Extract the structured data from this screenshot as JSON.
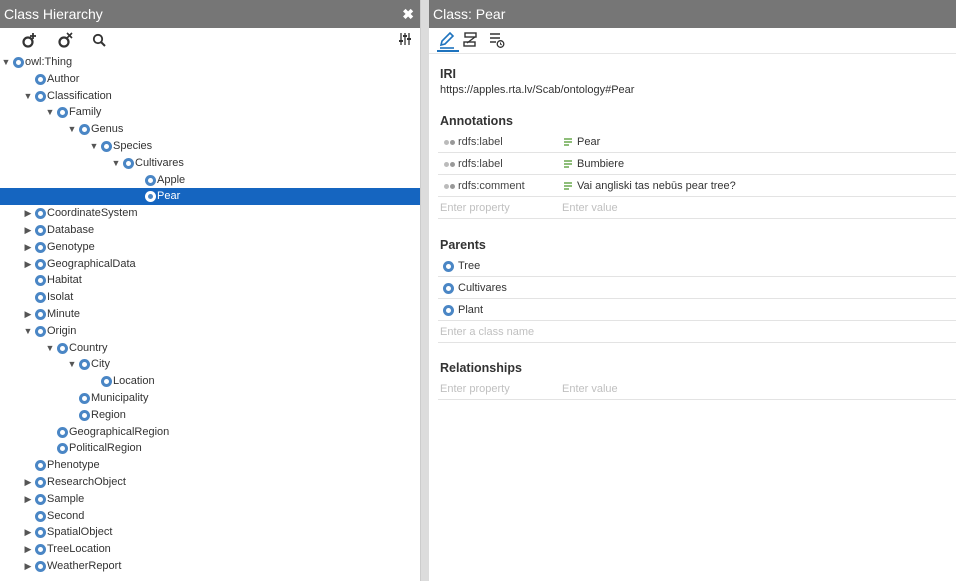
{
  "left_panel": {
    "title": "Class Hierarchy",
    "close_glyph": "✖",
    "tree": [
      {
        "label": "owl:Thing",
        "depth": 0,
        "state": "expanded"
      },
      {
        "label": "Author",
        "depth": 1,
        "state": "leaf"
      },
      {
        "label": "Classification",
        "depth": 1,
        "state": "expanded"
      },
      {
        "label": "Family",
        "depth": 2,
        "state": "expanded"
      },
      {
        "label": "Genus",
        "depth": 3,
        "state": "expanded"
      },
      {
        "label": "Species",
        "depth": 4,
        "state": "expanded"
      },
      {
        "label": "Cultivares",
        "depth": 5,
        "state": "expanded"
      },
      {
        "label": "Apple",
        "depth": 6,
        "state": "leaf"
      },
      {
        "label": "Pear",
        "depth": 6,
        "state": "leaf",
        "selected": true
      },
      {
        "label": "CoordinateSystem",
        "depth": 1,
        "state": "collapsed"
      },
      {
        "label": "Database",
        "depth": 1,
        "state": "collapsed"
      },
      {
        "label": "Genotype",
        "depth": 1,
        "state": "collapsed"
      },
      {
        "label": "GeographicalData",
        "depth": 1,
        "state": "collapsed"
      },
      {
        "label": "Habitat",
        "depth": 1,
        "state": "leaf"
      },
      {
        "label": "Isolat",
        "depth": 1,
        "state": "leaf"
      },
      {
        "label": "Minute",
        "depth": 1,
        "state": "collapsed"
      },
      {
        "label": "Origin",
        "depth": 1,
        "state": "expanded"
      },
      {
        "label": "Country",
        "depth": 2,
        "state": "expanded"
      },
      {
        "label": "City",
        "depth": 3,
        "state": "expanded"
      },
      {
        "label": "Location",
        "depth": 4,
        "state": "leaf"
      },
      {
        "label": "Municipality",
        "depth": 3,
        "state": "leaf"
      },
      {
        "label": "Region",
        "depth": 3,
        "state": "leaf"
      },
      {
        "label": "GeographicalRegion",
        "depth": 2,
        "state": "leaf"
      },
      {
        "label": "PoliticalRegion",
        "depth": 2,
        "state": "leaf"
      },
      {
        "label": "Phenotype",
        "depth": 1,
        "state": "leaf"
      },
      {
        "label": "ResearchObject",
        "depth": 1,
        "state": "collapsed"
      },
      {
        "label": "Sample",
        "depth": 1,
        "state": "collapsed"
      },
      {
        "label": "Second",
        "depth": 1,
        "state": "leaf"
      },
      {
        "label": "SpatialObject",
        "depth": 1,
        "state": "collapsed"
      },
      {
        "label": "TreeLocation",
        "depth": 1,
        "state": "collapsed"
      },
      {
        "label": "WeatherReport",
        "depth": 1,
        "state": "collapsed"
      }
    ]
  },
  "right_panel": {
    "title": "Class: Pear",
    "iri": {
      "heading": "IRI",
      "value": "https://apples.rta.lv/Scab/ontology#Pear"
    },
    "annotations": {
      "heading": "Annotations",
      "rows": [
        {
          "property": "rdfs:label",
          "value": "Pear"
        },
        {
          "property": "rdfs:label",
          "value": "Bumbiere"
        },
        {
          "property": "rdfs:comment",
          "value": "Vai angliski tas nebūs pear tree?"
        }
      ],
      "property_placeholder": "Enter property",
      "value_placeholder": "Enter value"
    },
    "parents": {
      "heading": "Parents",
      "items": [
        "Tree",
        "Cultivares",
        "Plant"
      ],
      "placeholder": "Enter a class name"
    },
    "relationships": {
      "heading": "Relationships",
      "property_placeholder": "Enter property",
      "value_placeholder": "Enter value"
    }
  },
  "colors": {
    "header_bg": "#767676",
    "selection": "#1565c0",
    "class_dot": "#4a86c5",
    "literal_icon": "#6aa84f",
    "tab_active": "#1e73be"
  }
}
